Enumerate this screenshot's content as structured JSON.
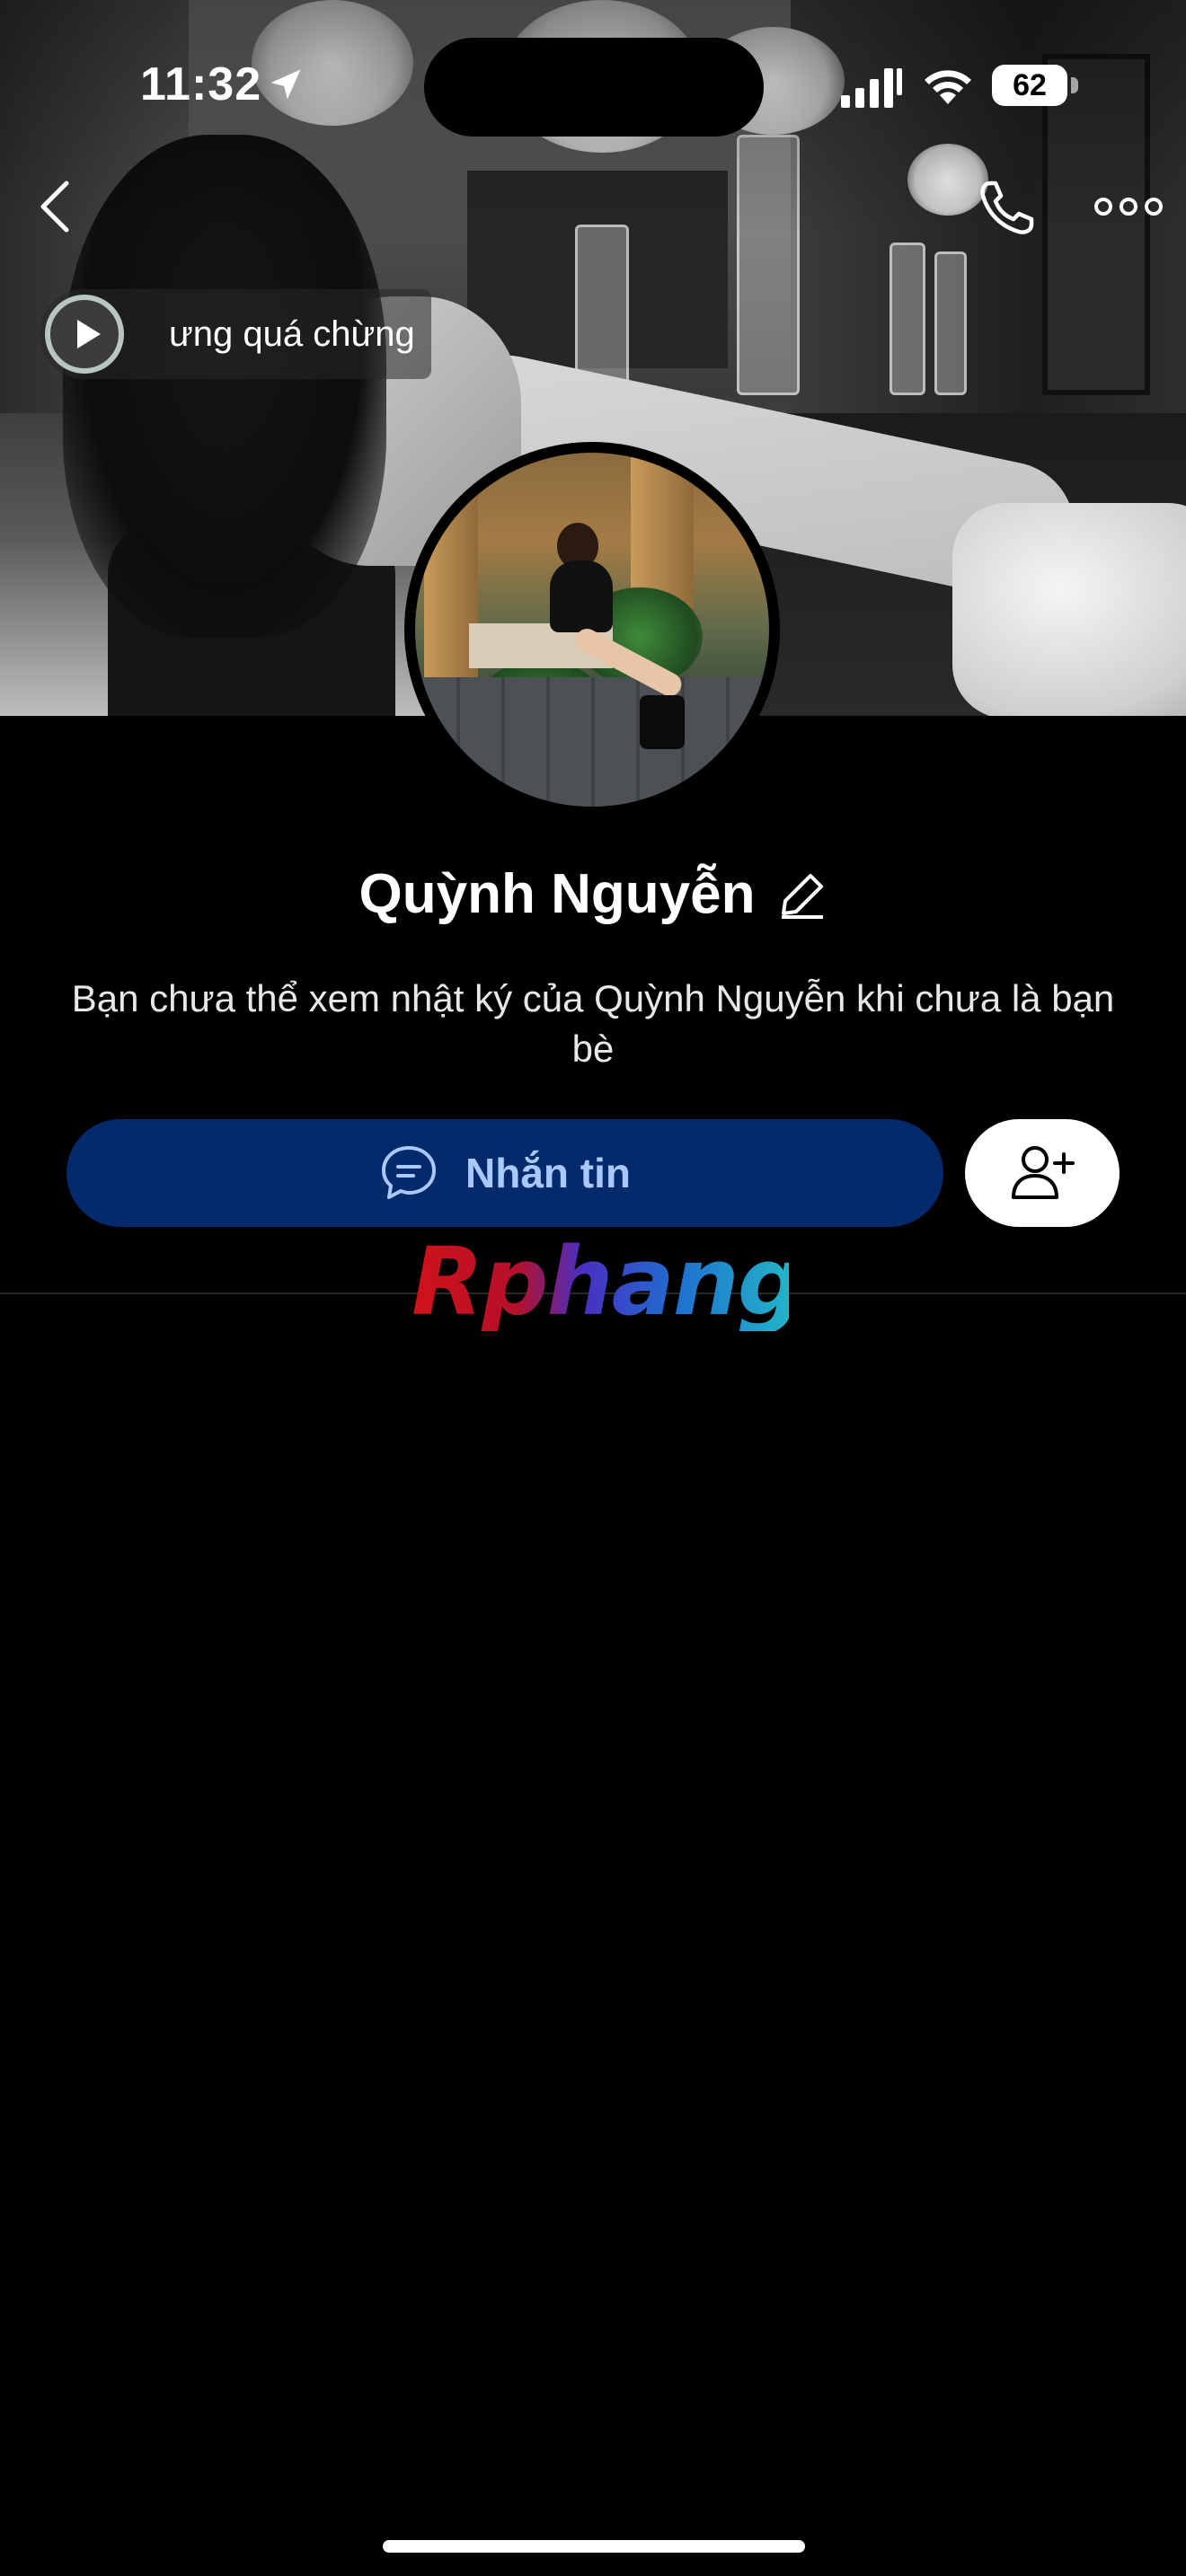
{
  "status_bar": {
    "time": "11:32",
    "battery": "62",
    "icons": [
      "location-arrow-icon",
      "cellular-signal-icon",
      "wifi-icon",
      "battery-icon"
    ]
  },
  "nav": {
    "icons": [
      "back-chevron-icon",
      "phone-call-icon",
      "more-options-icon"
    ]
  },
  "music": {
    "title": "ưng quá chừng",
    "icon": "play-icon"
  },
  "profile": {
    "name": "Quỳnh Nguyễn",
    "notice": "Bạn chưa thể xem nhật ký của Quỳnh Nguyễn khi chưa là bạn bè"
  },
  "actions": {
    "message_label": "Nhắn tin",
    "message_icon": "chat-bubble-icon",
    "add_friend_icon": "add-friend-icon"
  },
  "watermark": {
    "text": "Rphang"
  },
  "colors": {
    "background": "#000000",
    "message_button": "#042a6c",
    "message_text": "#a9c8ff",
    "add_friend_button": "#ffffff"
  }
}
